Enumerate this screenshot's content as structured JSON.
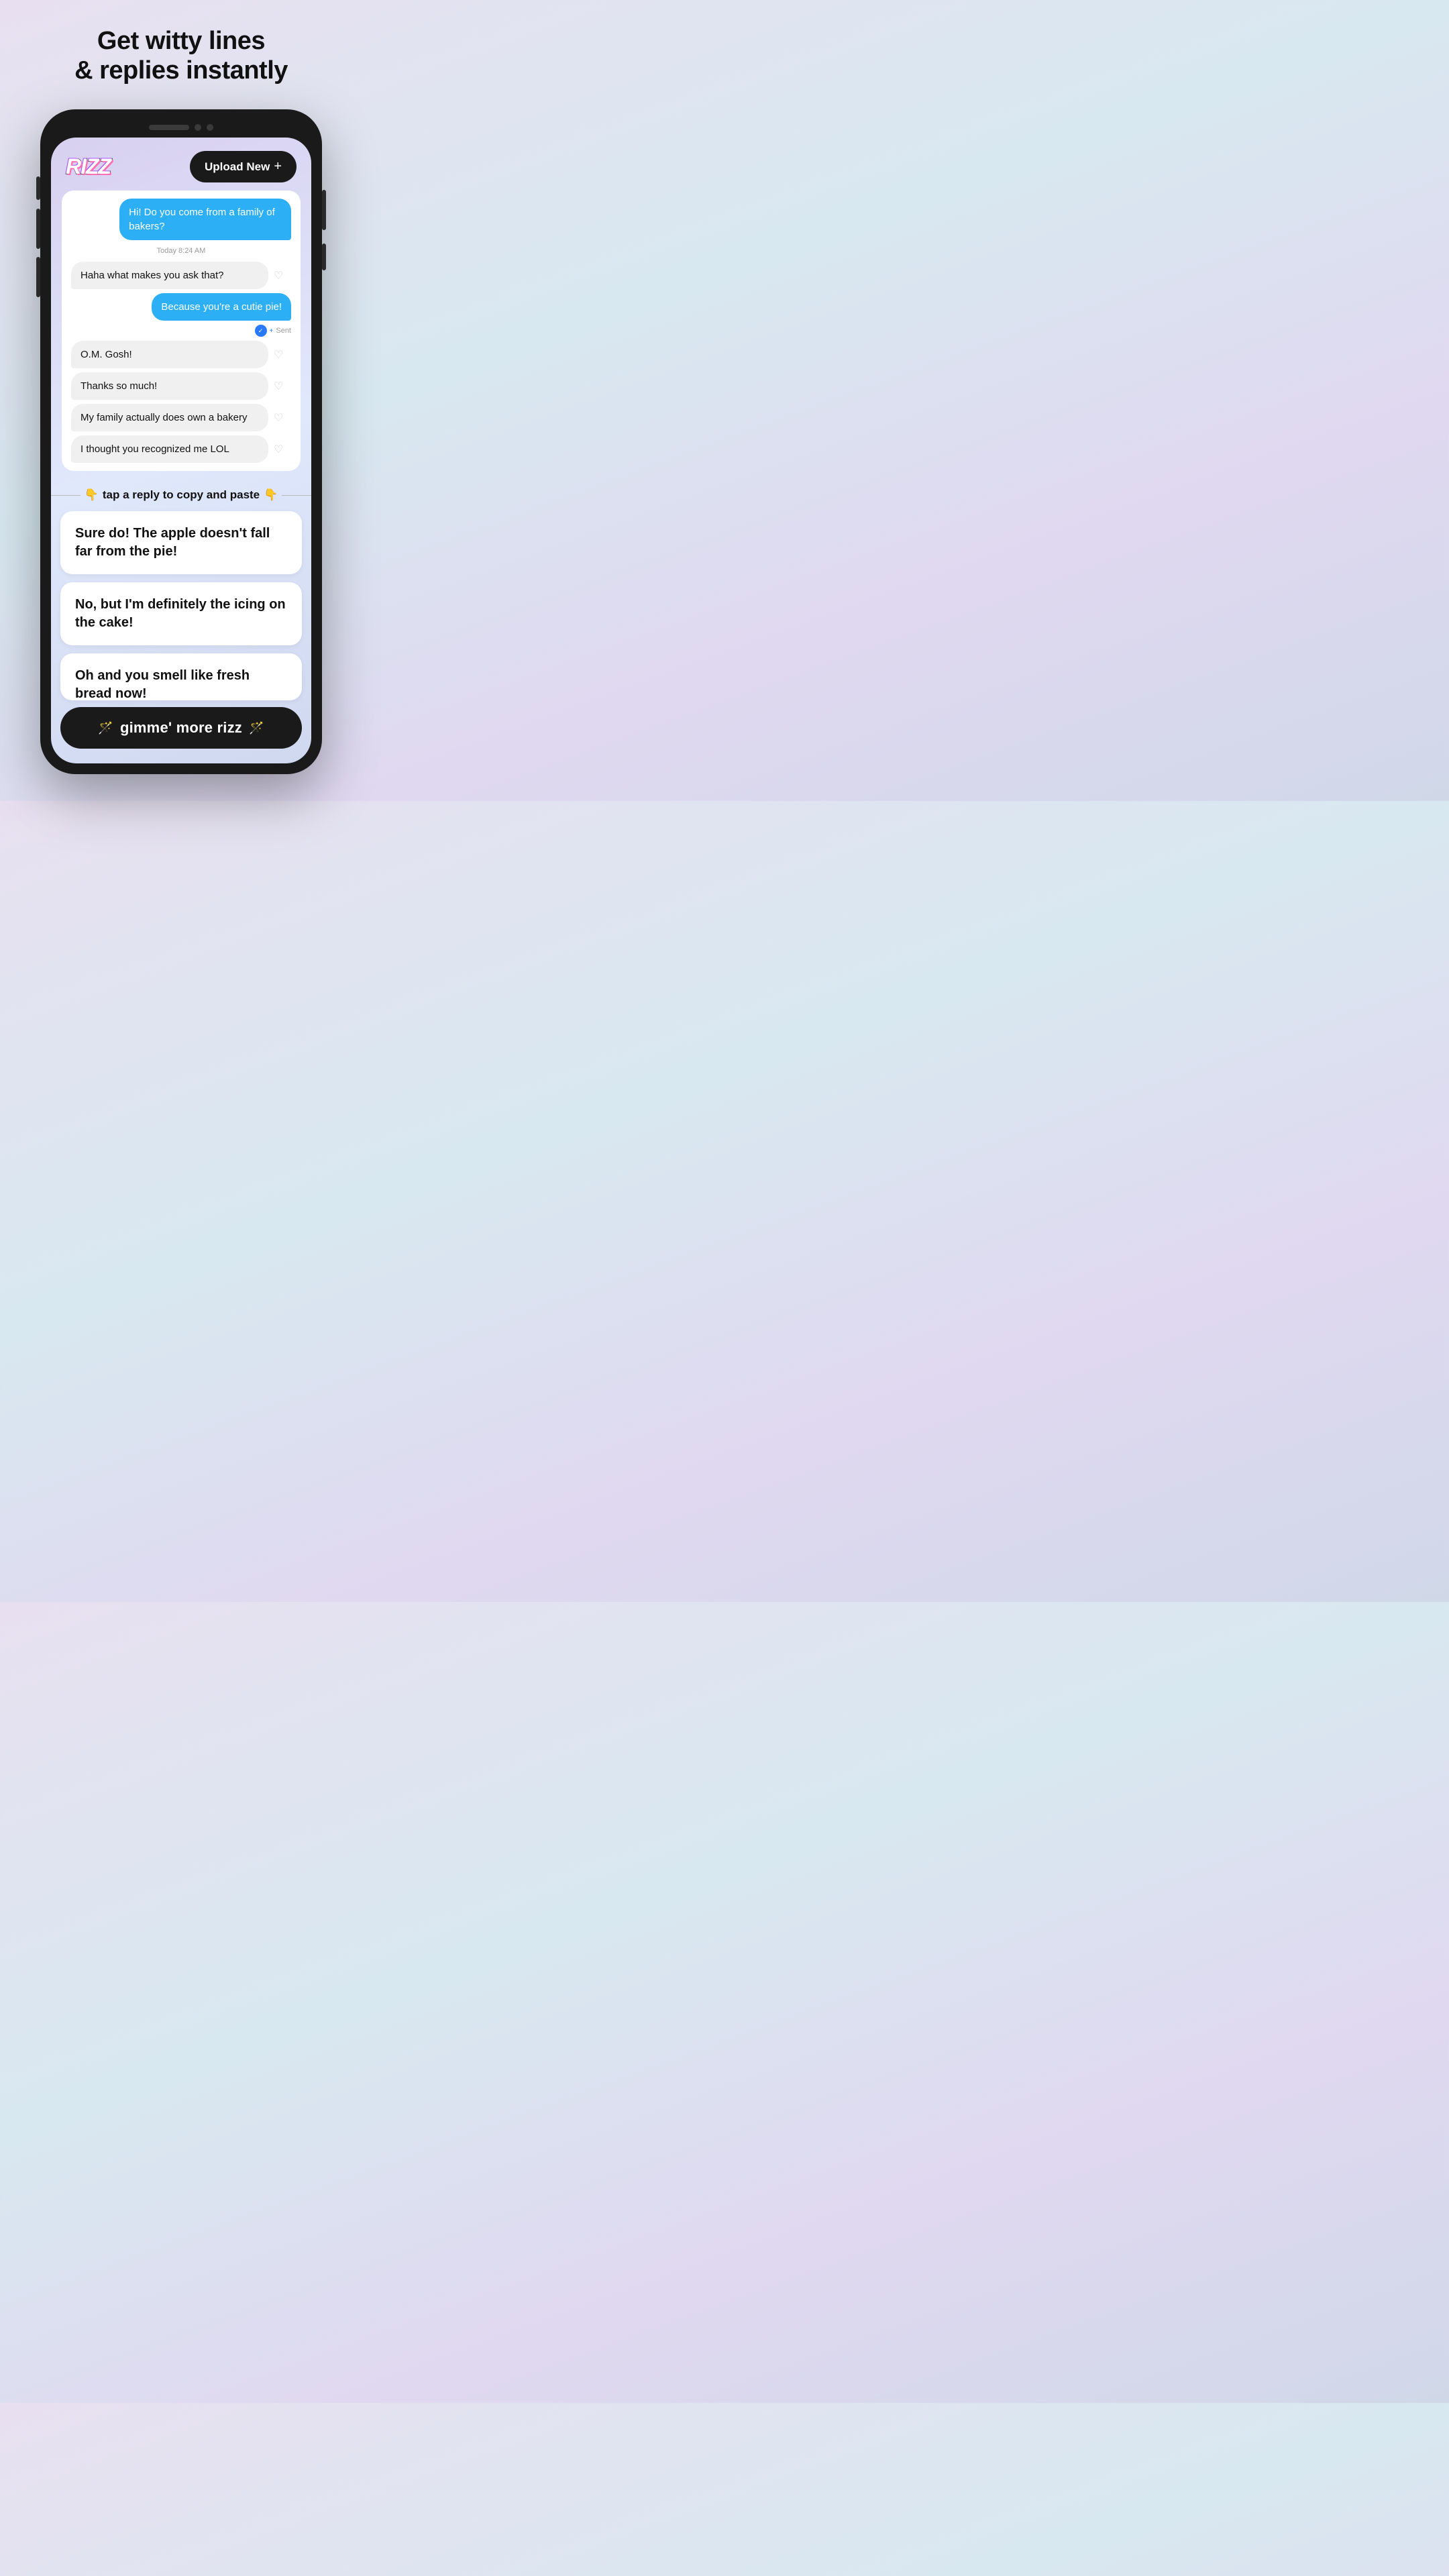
{
  "page": {
    "title_line1": "Get witty lines",
    "title_line2": "& replies instantly"
  },
  "header": {
    "logo": "RIZZ",
    "upload_button_label": "Upload New",
    "upload_icon": "+"
  },
  "chat": {
    "sent_messages": [
      {
        "text": "Hi!  Do you come from a family of bakers?"
      },
      {
        "text": "Because you're a cutie pie!"
      }
    ],
    "timestamp": "Today 8:24 AM",
    "sent_status": "Sent",
    "received_messages": [
      {
        "text": "Haha what makes you ask that?"
      },
      {
        "text": "O.M. Gosh!"
      },
      {
        "text": "Thanks so much!"
      },
      {
        "text": "My family actually does own a bakery"
      },
      {
        "text": "I thought you recognized me LOL"
      }
    ]
  },
  "instruction": {
    "emoji_left": "👇",
    "text": "tap a reply to copy and paste",
    "emoji_right": "👇"
  },
  "replies": [
    {
      "text": "Sure do! The apple doesn't fall far from the pie!"
    },
    {
      "text": "No, but I'm definitely the icing on the cake!"
    },
    {
      "text": "Oh and you smell like fresh bread now!"
    }
  ],
  "gimme_button": {
    "label": "gimme' more rizz",
    "icon_left": "🪄",
    "icon_right": "🪄"
  }
}
